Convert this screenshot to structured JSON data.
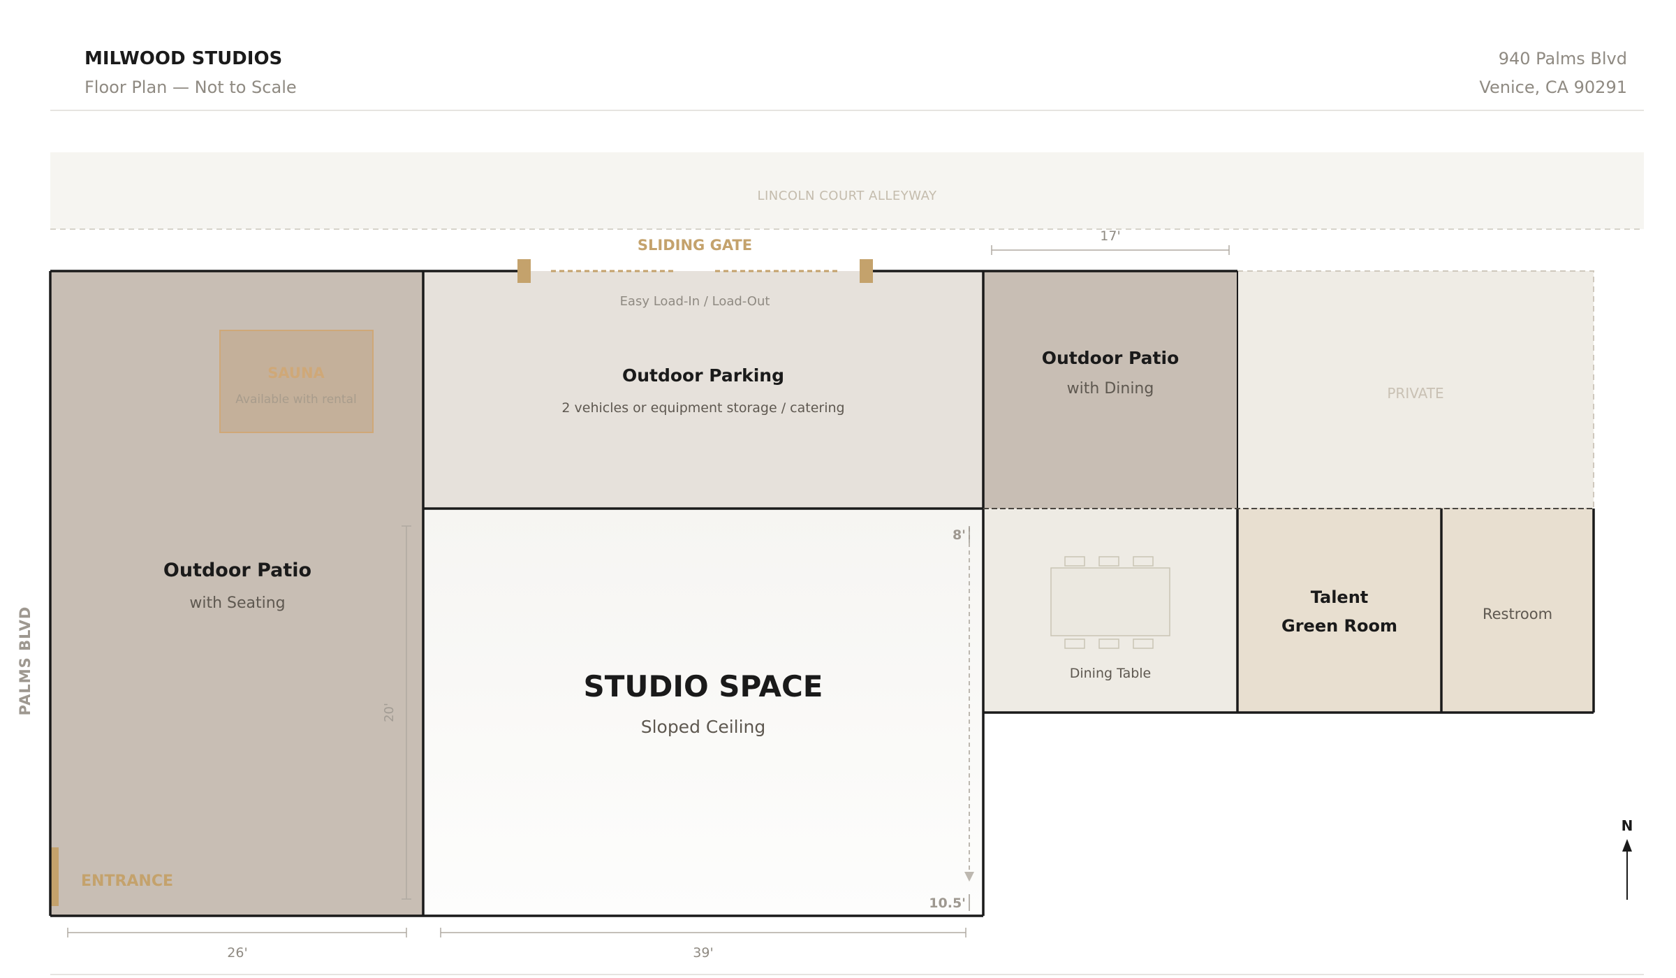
{
  "header": {
    "studio_name": "MILWOOD STUDIOS",
    "subtitle": "Floor Plan — Not to Scale",
    "address_line1": "940 Palms Blvd",
    "address_line2": "Venice, CA 90291"
  },
  "street_labels": {
    "alley": "LINCOLN COURT ALLEYWAY",
    "side_street": "PALMS BLVD"
  },
  "gate": {
    "label": "SLIDING GATE",
    "note": "Easy Load-In / Load-Out"
  },
  "rooms": {
    "patio_west": {
      "title": "Outdoor Patio",
      "subtitle": "with Seating"
    },
    "sauna": {
      "title": "SAUNA",
      "subtitle": "Available with rental"
    },
    "parking": {
      "title": "Outdoor Parking",
      "subtitle": "2 vehicles or equipment storage / catering"
    },
    "patio_north": {
      "title": "Outdoor Patio",
      "subtitle": "with Dining"
    },
    "private": {
      "title": "PRIVATE"
    },
    "dining": {
      "label": "Dining Table"
    },
    "green_room": {
      "line1": "Talent",
      "line2": "Green Room"
    },
    "restroom": {
      "title": "Restroom"
    },
    "studio": {
      "title": "STUDIO SPACE",
      "subtitle": "Sloped Ceiling"
    },
    "entrance": {
      "label": "ENTRANCE"
    }
  },
  "dimensions": {
    "west_width": "26'",
    "studio_width": "39'",
    "patio_north_width": "17'",
    "west_depth": "20'",
    "ceiling_high": "8'",
    "ceiling_low": "10.5'"
  },
  "compass": {
    "label": "N"
  },
  "colors": {
    "patio": "#c8beb4",
    "parking": "#e6e1db",
    "studio": "#fafaf9",
    "private": "#efece5",
    "dining_area": "#eeebe4",
    "green_room": "#e8dfd0",
    "accent_gold": "#c4a26c",
    "wall": "#1a1a1a"
  }
}
